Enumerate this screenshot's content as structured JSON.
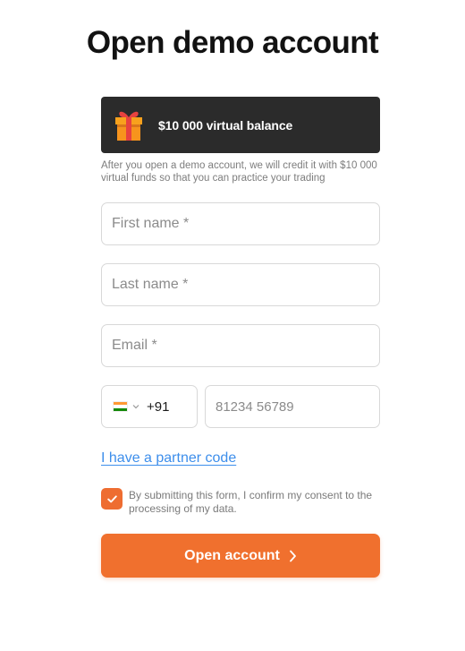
{
  "header": {
    "title": "Open demo account"
  },
  "promo": {
    "icon": "gift-icon",
    "text": "$10 000 virtual balance",
    "note": "After you open a demo account, we will credit it with $10 000 virtual funds so that you can practice your trading"
  },
  "form": {
    "first_name": {
      "placeholder": "First name *",
      "value": ""
    },
    "last_name": {
      "placeholder": "Last name *",
      "value": ""
    },
    "email": {
      "placeholder": "Email *",
      "value": ""
    },
    "phone": {
      "country_flag": "india-flag-icon",
      "dial_code": "+91",
      "placeholder": "81234 56789",
      "value": ""
    },
    "partner_link": "I have a partner code",
    "consent": {
      "checked": true,
      "text": "By submitting this form, I confirm my consent to the processing of my data."
    },
    "submit_label": "Open account"
  },
  "colors": {
    "accent": "#f0702e",
    "banner_bg": "#2b2b2b",
    "link": "#3d8eeb"
  }
}
